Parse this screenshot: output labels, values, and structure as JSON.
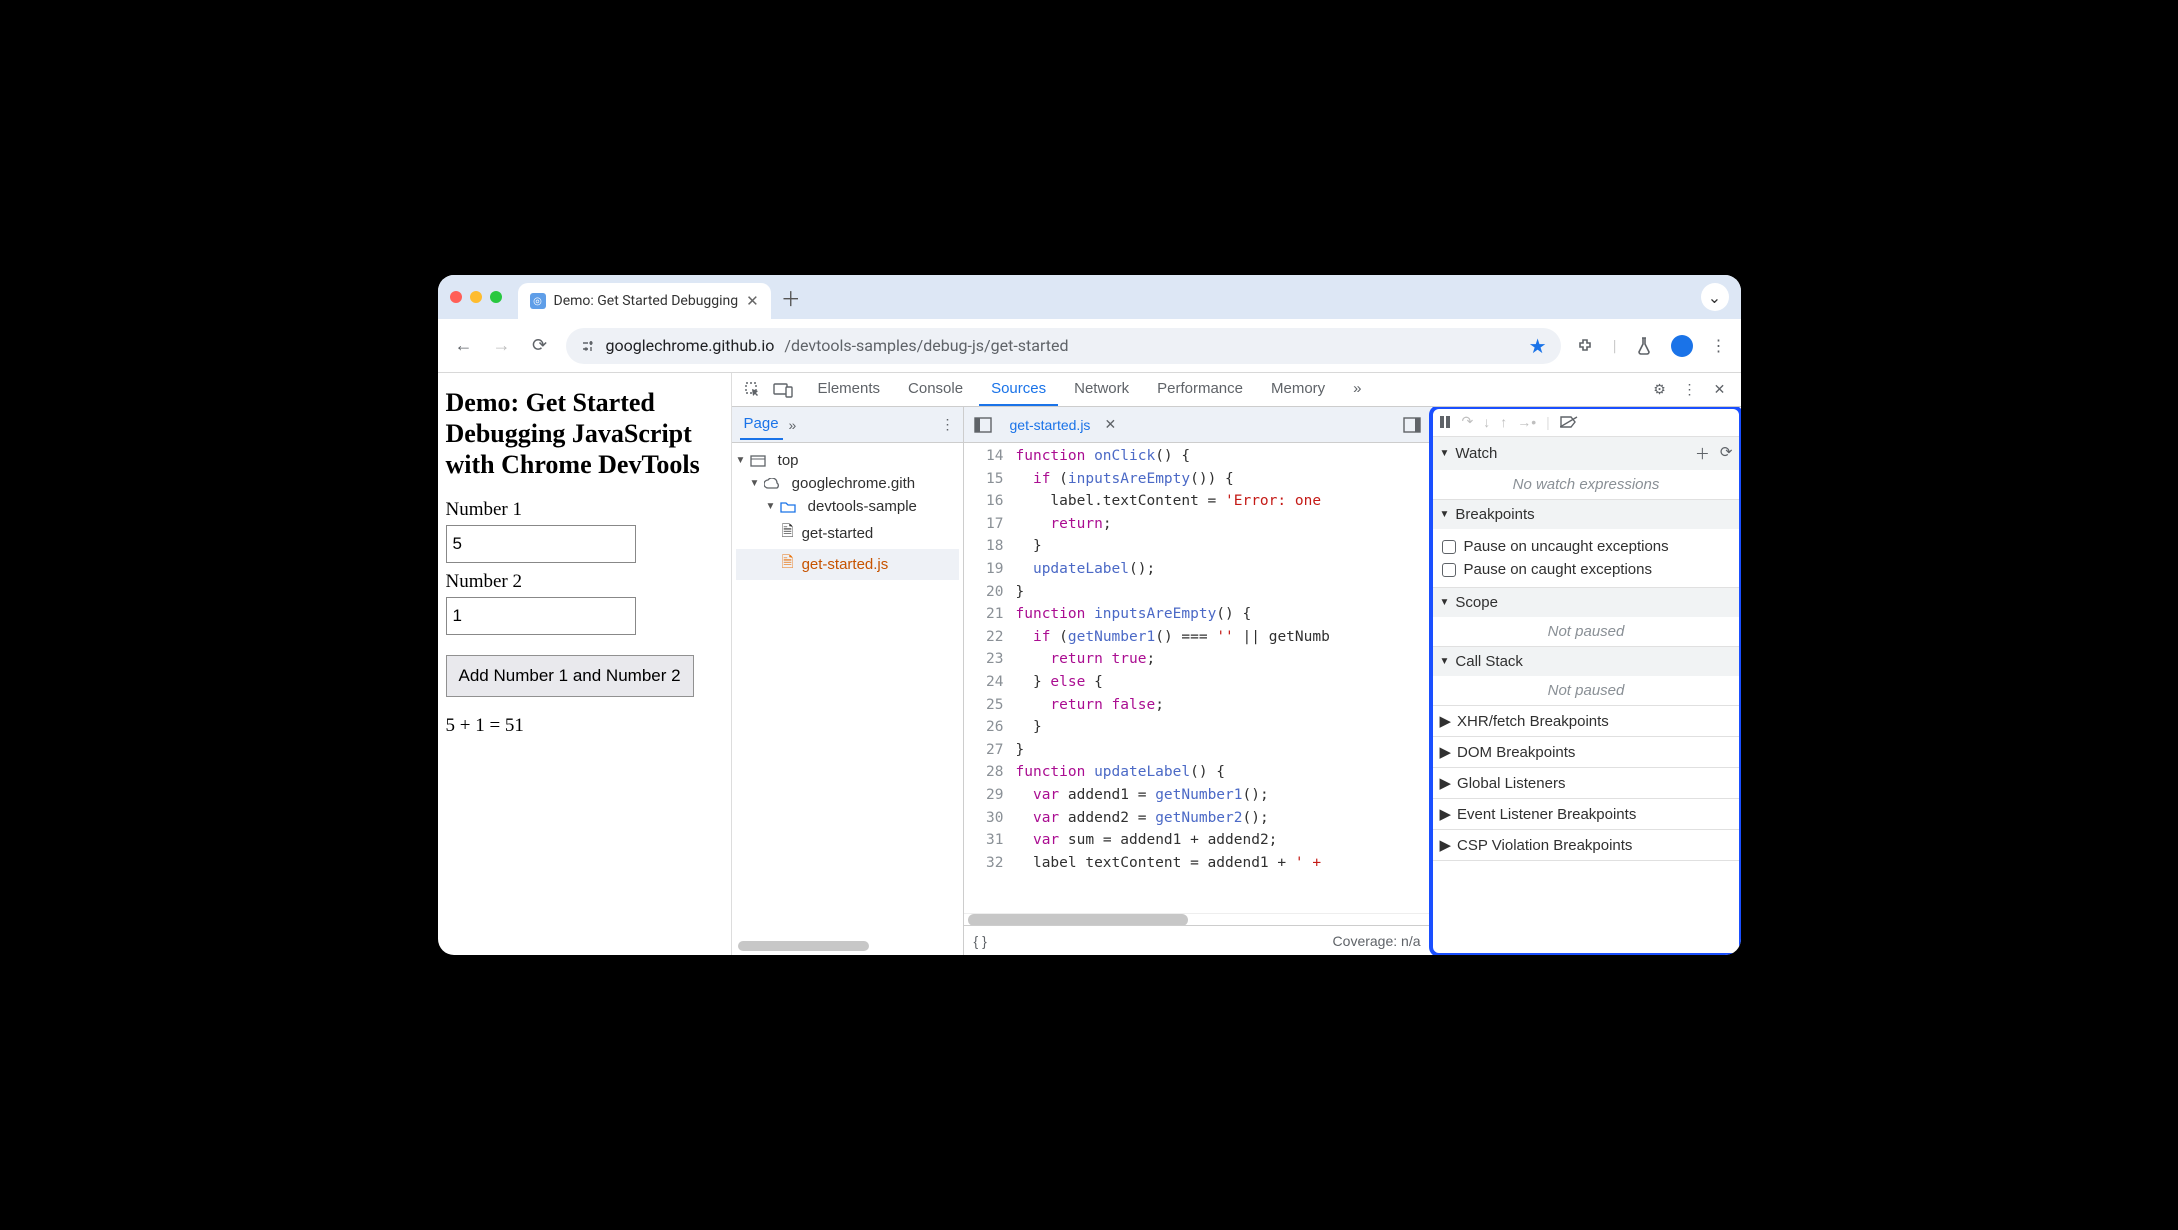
{
  "tab": {
    "title": "Demo: Get Started Debugging"
  },
  "url": {
    "host": "googlechrome.github.io",
    "path": "/devtools-samples/debug-js/get-started"
  },
  "page": {
    "heading": "Demo: Get Started Debugging JavaScript with Chrome DevTools",
    "num1_label": "Number 1",
    "num1_value": "5",
    "num2_label": "Number 2",
    "num2_value": "1",
    "button": "Add Number 1 and Number 2",
    "result": "5 + 1 = 51"
  },
  "devtools": {
    "tabs": [
      "Elements",
      "Console",
      "Sources",
      "Network",
      "Performance",
      "Memory"
    ],
    "active_tab": "Sources",
    "navigator": {
      "page_tab": "Page",
      "tree": {
        "top": "top",
        "domain": "googlechrome.gith",
        "folder": "devtools-sample",
        "files": [
          "get-started",
          "get-started.js"
        ]
      }
    },
    "editor": {
      "filename": "get-started.js",
      "first_line": 14,
      "lines": [
        "function onClick() {",
        "  if (inputsAreEmpty()) {",
        "    label.textContent = 'Error: one",
        "    return;",
        "  }",
        "  updateLabel();",
        "}",
        "function inputsAreEmpty() {",
        "  if (getNumber1() === '' || getNumb",
        "    return true;",
        "  } else {",
        "    return false;",
        "  }",
        "}",
        "function updateLabel() {",
        "  var addend1 = getNumber1();",
        "  var addend2 = getNumber2();",
        "  var sum = addend1 + addend2;",
        "  label textContent = addend1 + ' +"
      ],
      "coverage": "Coverage: n/a"
    },
    "debugger": {
      "watch": {
        "title": "Watch",
        "empty": "No watch expressions"
      },
      "breakpoints": {
        "title": "Breakpoints",
        "options": [
          "Pause on uncaught exceptions",
          "Pause on caught exceptions"
        ]
      },
      "scope": {
        "title": "Scope",
        "empty": "Not paused"
      },
      "callstack": {
        "title": "Call Stack",
        "empty": "Not paused"
      },
      "collapsed": [
        "XHR/fetch Breakpoints",
        "DOM Breakpoints",
        "Global Listeners",
        "Event Listener Breakpoints",
        "CSP Violation Breakpoints"
      ]
    }
  }
}
